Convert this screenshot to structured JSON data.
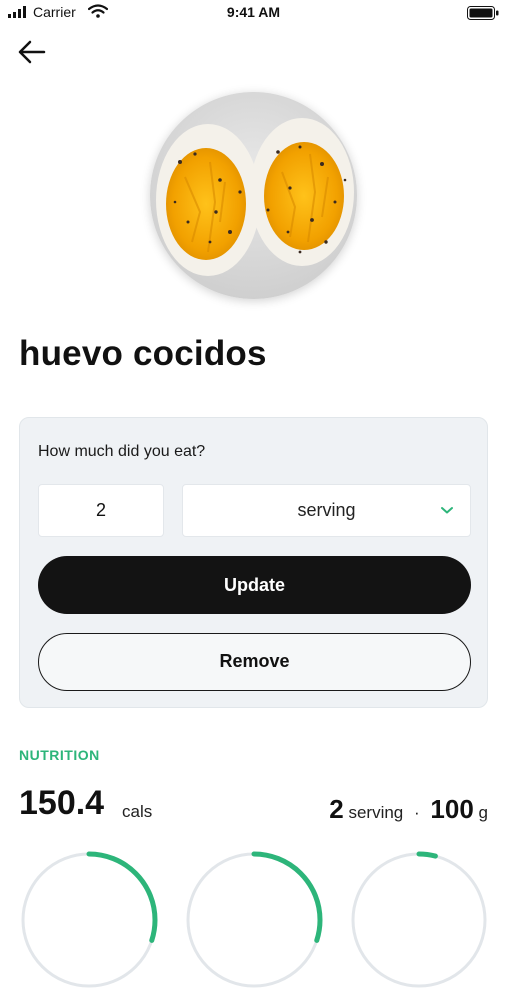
{
  "status_bar": {
    "carrier": "Carrier",
    "time": "9:41 AM"
  },
  "food": {
    "name": "huevo cocidos"
  },
  "portion": {
    "question": "How much did you eat?",
    "quantity": "2",
    "unit": "serving",
    "update_label": "Update",
    "remove_label": "Remove"
  },
  "nutrition": {
    "section_label": "NUTRITION",
    "calories": "150.4",
    "calories_unit": "cals",
    "servings": "2",
    "servings_unit": "serving",
    "separator": "·",
    "weight": "100",
    "weight_unit": "g",
    "macro_rings": [
      {
        "fraction": 0.3
      },
      {
        "fraction": 0.3
      },
      {
        "fraction": 0.04
      }
    ]
  },
  "colors": {
    "accent": "#2db57a",
    "ring_track": "#e2e6ea",
    "primary_button": "#131313"
  },
  "icons": [
    "signal-icon",
    "wifi-icon",
    "battery-icon",
    "back-arrow-icon",
    "chevron-down-icon"
  ]
}
